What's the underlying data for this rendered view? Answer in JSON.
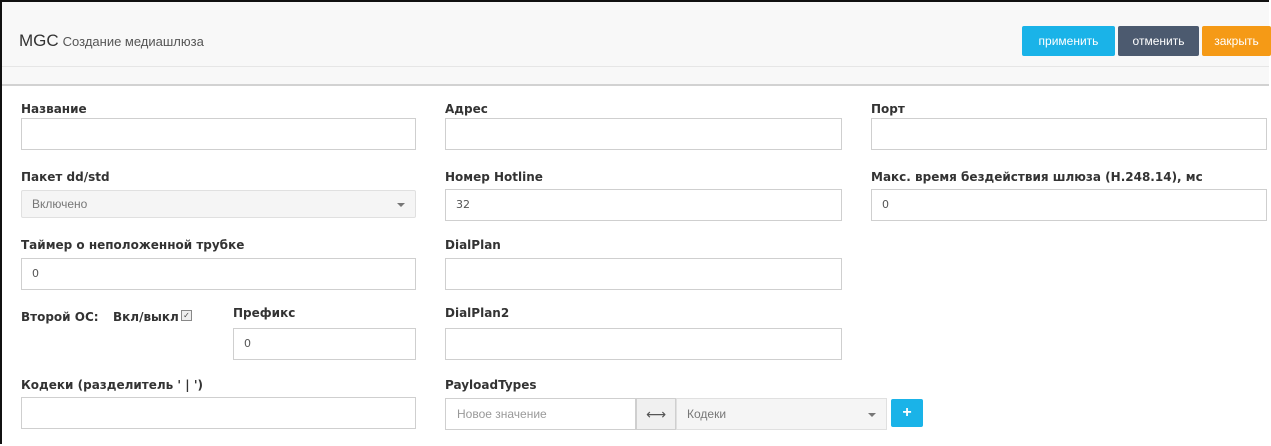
{
  "header": {
    "app_name": "MGC",
    "subtitle": "Создание медиашлюза",
    "apply_label": "применить",
    "cancel_label": "отменить",
    "close_label": "закрыть"
  },
  "fields": {
    "name": {
      "label": "Название",
      "value": ""
    },
    "address": {
      "label": "Адрес",
      "value": ""
    },
    "port": {
      "label": "Порт",
      "value": ""
    },
    "dd_std": {
      "label": "Пакет dd/std",
      "value": "Включено"
    },
    "hotline": {
      "label": "Номер Hotline",
      "value": "32"
    },
    "idle_time": {
      "label": "Макс. время бездействия шлюза (H.248.14), мс",
      "value": "0"
    },
    "offhook_timer": {
      "label": "Таймер о неположенной трубке",
      "value": "0"
    },
    "dialplan": {
      "label": "DialPlan",
      "value": ""
    },
    "second_os": {
      "label": "Второй ОС:",
      "toggle_label": "Вкл/выкл",
      "checked": true
    },
    "prefix": {
      "label": "Префикс",
      "value": "0"
    },
    "dialplan2": {
      "label": "DialPlan2",
      "value": ""
    },
    "codecs": {
      "label": "Кодеки (разделитель ' | ')",
      "value": ""
    },
    "payload_types": {
      "label": "PayloadTypes",
      "placeholder": "Новое значение",
      "select_value": "Кодеки"
    }
  }
}
